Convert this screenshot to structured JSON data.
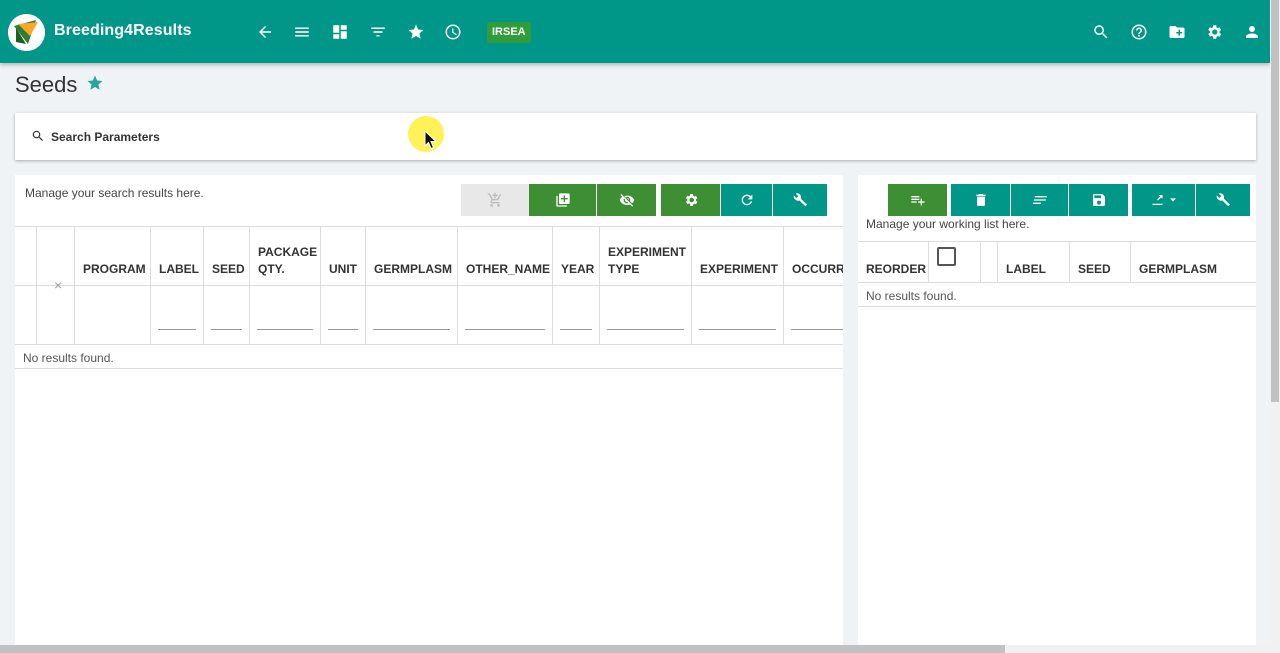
{
  "header": {
    "brand": "Breeding4Results",
    "program_badge": "IRSEA",
    "nav_icons": [
      "back-arrow-icon",
      "menu-icon",
      "dashboard-icon",
      "filter-icon",
      "star-icon",
      "history-icon"
    ],
    "right_icons": [
      "search-icon",
      "help-icon",
      "folder-icon",
      "gear-icon",
      "user-icon"
    ],
    "color": "#009688"
  },
  "page": {
    "title": "Seeds"
  },
  "search_params": {
    "label": "Search Parameters"
  },
  "results": {
    "manage_text": "Manage your search results here.",
    "columns": [
      {
        "label": "PROGRAM"
      },
      {
        "label": "LABEL"
      },
      {
        "label": "SEED"
      },
      {
        "label": "PACKAGE QTY."
      },
      {
        "label": "UNIT"
      },
      {
        "label": "GERMPLASM"
      },
      {
        "label": "OTHER_NAME"
      },
      {
        "label": "YEAR"
      },
      {
        "label": "EXPERIMENT TYPE"
      },
      {
        "label": "EXPERIMENT"
      },
      {
        "label": "OCCURRE"
      }
    ],
    "clear_symbol": "×",
    "empty_text": "No results found."
  },
  "working_list": {
    "manage_text": "Manage your working list here.",
    "columns": [
      {
        "label": "REORDER"
      },
      {
        "label": ""
      },
      {
        "label": ""
      },
      {
        "label": "LABEL"
      },
      {
        "label": "SEED"
      },
      {
        "label": "GERMPLASM"
      }
    ],
    "empty_text": "No results found."
  }
}
